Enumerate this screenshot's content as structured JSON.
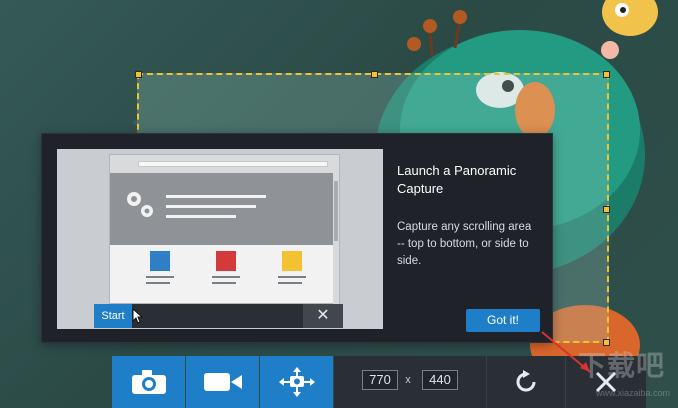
{
  "dialog": {
    "title": "Launch a Panoramic Capture",
    "description": "Capture any scrolling area -- top to bottom, or side to side.",
    "got_it_label": "Got it!",
    "preview": {
      "start_label": "Start",
      "close_glyph": "✕"
    }
  },
  "toolbar": {
    "width_value": "770",
    "x_label": "x",
    "height_value": "440",
    "buttons": [
      {
        "name": "image-capture-button",
        "icon": "camera-icon"
      },
      {
        "name": "video-capture-button",
        "icon": "video-camera-icon"
      },
      {
        "name": "panoramic-capture-button",
        "icon": "panoramic-move-icon"
      },
      {
        "name": "restart-button",
        "icon": "restart-icon"
      },
      {
        "name": "close-button",
        "icon": "close-icon"
      }
    ]
  },
  "watermark": {
    "text": "下载吧",
    "url": "www.xiazaiba.com"
  },
  "colors": {
    "accent_blue": "#1e7fc8",
    "toolbar_dark": "#2a2f35",
    "selection_border": "#f2c230",
    "dialog_bg": "#1f2329"
  }
}
